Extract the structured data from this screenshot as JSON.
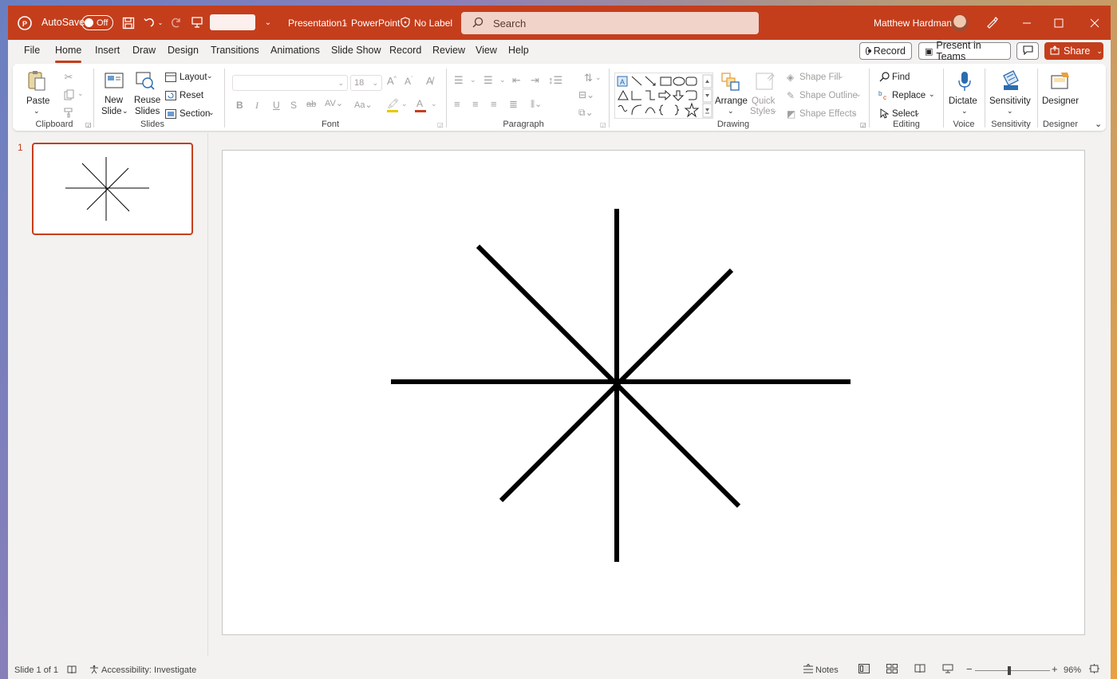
{
  "titlebar": {
    "autosave_label": "AutoSave",
    "autosave_state": "Off",
    "doc_title": "Presentation1",
    "app_name": "PowerPoint",
    "title_sep": "-",
    "sensitivity_label": "No Label",
    "search_placeholder": "Search",
    "user_name": "Matthew Hardman"
  },
  "tabs": [
    "File",
    "Home",
    "Insert",
    "Draw",
    "Design",
    "Transitions",
    "Animations",
    "Slide Show",
    "Record",
    "Review",
    "View",
    "Help"
  ],
  "active_tab": "Home",
  "right_buttons": {
    "record": "Record",
    "present_teams": "Present in Teams",
    "share": "Share"
  },
  "ribbon": {
    "clipboard": {
      "label": "Clipboard",
      "paste": "Paste"
    },
    "slides": {
      "label": "Slides",
      "new_slide_1": "New",
      "new_slide_2": "Slide",
      "reuse_1": "Reuse",
      "reuse_2": "Slides",
      "layout": "Layout",
      "reset": "Reset",
      "section": "Section"
    },
    "font": {
      "label": "Font",
      "font_size": "18"
    },
    "paragraph": {
      "label": "Paragraph"
    },
    "drawing": {
      "label": "Drawing",
      "arrange": "Arrange",
      "quick_1": "Quick",
      "quick_2": "Styles",
      "shape_fill": "Shape Fill",
      "shape_outline": "Shape Outline",
      "shape_effects": "Shape Effects"
    },
    "editing": {
      "label": "Editing",
      "find": "Find",
      "replace": "Replace",
      "select": "Select"
    },
    "voice": {
      "label": "Voice",
      "dictate": "Dictate"
    },
    "sensitivity": {
      "label": "Sensitivity",
      "button": "Sensitivity"
    },
    "designer": {
      "label": "Designer",
      "button": "Designer"
    }
  },
  "slides_pane": {
    "slide_number": "1"
  },
  "status": {
    "slide_info": "Slide 1 of 1",
    "accessibility": "Accessibility: Investigate",
    "notes": "Notes",
    "zoom": "96%"
  },
  "colors": {
    "accent": "#c43e1c",
    "search_bg": "#f1d3ca",
    "ribbon_bg": "#ffffff",
    "app_bg": "#f3f2f1"
  }
}
